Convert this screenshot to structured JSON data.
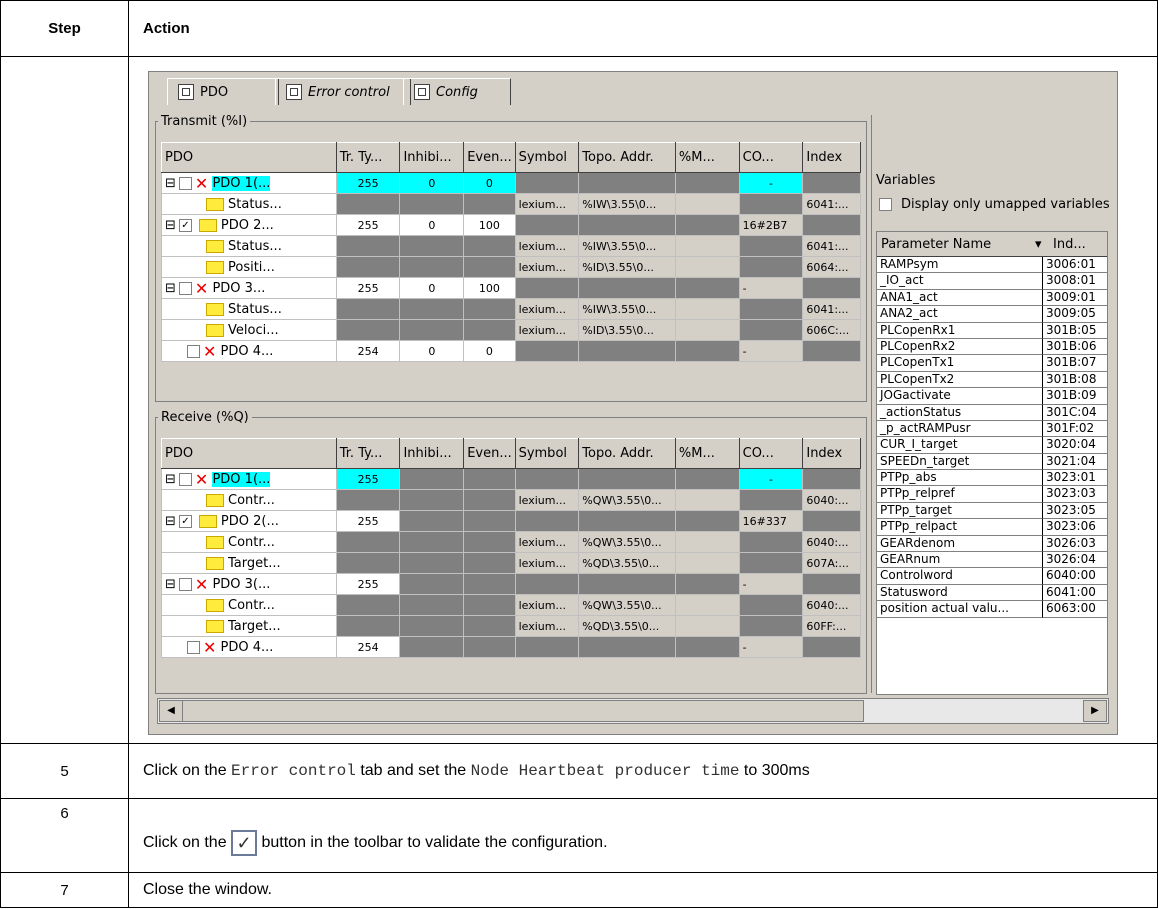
{
  "header": {
    "step": "Step",
    "action": "Action"
  },
  "window": {
    "tabs": [
      "PDO",
      "Error control",
      "Config"
    ],
    "transmit_title": "Transmit (%I)",
    "receive_title": "Receive (%Q)",
    "columns": [
      "PDO",
      "Tr. Ty...",
      "Inhibi...",
      "Even...",
      "Symbol",
      "Topo. Addr.",
      "%M...",
      "CO...",
      "Index"
    ],
    "variables_label": "Variables",
    "only_unmapped": "Display only umapped variables",
    "param_header": "Parameter Name",
    "index_header": "Ind...",
    "params": [
      [
        "RAMPsym",
        "3006:01"
      ],
      [
        "_IO_act",
        "3008:01"
      ],
      [
        "ANA1_act",
        "3009:01"
      ],
      [
        "ANA2_act",
        "3009:05"
      ],
      [
        "PLCopenRx1",
        "301B:05"
      ],
      [
        "PLCopenRx2",
        "301B:06"
      ],
      [
        "PLCopenTx1",
        "301B:07"
      ],
      [
        "PLCopenTx2",
        "301B:08"
      ],
      [
        "JOGactivate",
        "301B:09"
      ],
      [
        "_actionStatus",
        "301C:04"
      ],
      [
        "_p_actRAMPusr",
        "301F:02"
      ],
      [
        "CUR_I_target",
        "3020:04"
      ],
      [
        "SPEEDn_target",
        "3021:04"
      ],
      [
        "PTPp_abs",
        "3023:01"
      ],
      [
        "PTPp_relpref",
        "3023:03"
      ],
      [
        "PTPp_target",
        "3023:05"
      ],
      [
        "PTPp_relpact",
        "3023:06"
      ],
      [
        "GEARdenom",
        "3026:03"
      ],
      [
        "GEARnum",
        "3026:04"
      ],
      [
        "Controlword",
        "6040:00"
      ],
      [
        "Statusword",
        "6041:00"
      ],
      [
        "position actual valu...",
        "6063:00"
      ]
    ]
  },
  "steps": [
    {
      "num": "5",
      "pre": "Click on the ",
      "code1": "Error control",
      "mid": " tab and set the ",
      "code2": "Node Heartbeat producer time",
      "post": " to 300ms"
    },
    {
      "num": "6",
      "pre": "Click on the ",
      "post": " button in the toolbar to validate the configuration."
    },
    {
      "num": "7",
      "text": "Close the window."
    }
  ]
}
